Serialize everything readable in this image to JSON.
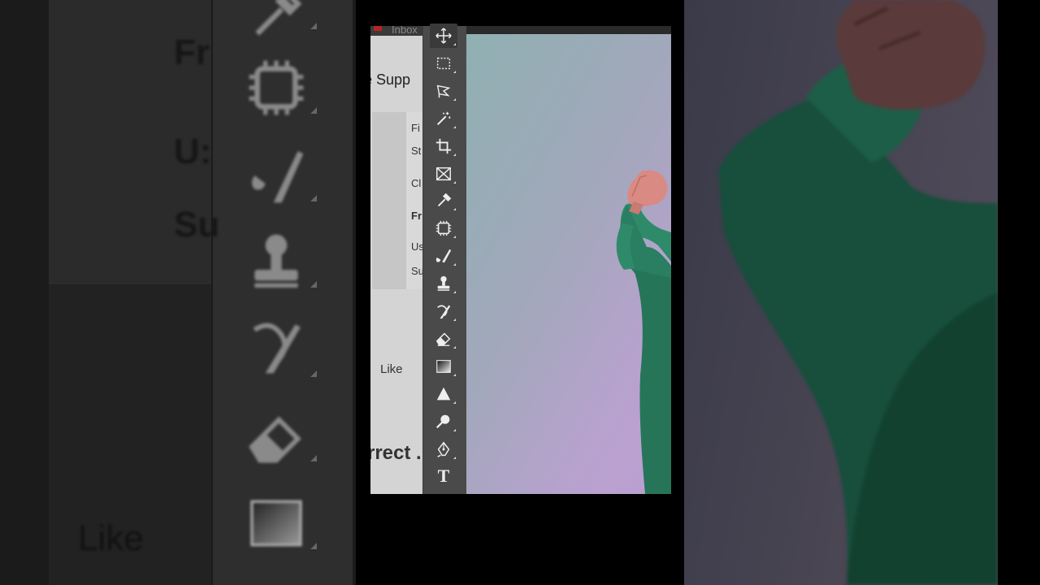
{
  "web_panel": {
    "tab_label": "Inbox",
    "heading": "e Supp",
    "labels": [
      "Fi",
      "St",
      "Cl",
      "Fr",
      "Us",
      "Su"
    ],
    "like_label": "Like",
    "footer_text": "rrect ."
  },
  "left_backdrop": {
    "labels": [
      "Fr",
      "U:",
      "Su"
    ],
    "like_label": "Like"
  },
  "toolbar": {
    "tools": [
      {
        "name": "move-tool",
        "icon": "move-icon",
        "active": true
      },
      {
        "name": "marquee-tool",
        "icon": "rectangle-marquee-icon"
      },
      {
        "name": "lasso-tool",
        "icon": "polygonal-lasso-icon"
      },
      {
        "name": "magic-wand-tool",
        "icon": "magic-wand-icon"
      },
      {
        "name": "crop-tool",
        "icon": "crop-icon"
      },
      {
        "name": "frame-tool",
        "icon": "frame-icon"
      },
      {
        "name": "eyedropper-tool",
        "icon": "eyedropper-icon"
      },
      {
        "name": "spot-healing-tool",
        "icon": "healing-patch-icon"
      },
      {
        "name": "brush-tool",
        "icon": "brush-icon"
      },
      {
        "name": "clone-stamp-tool",
        "icon": "stamp-icon"
      },
      {
        "name": "history-brush-tool",
        "icon": "history-brush-icon"
      },
      {
        "name": "eraser-tool",
        "icon": "eraser-icon"
      },
      {
        "name": "gradient-tool",
        "icon": "gradient-icon"
      },
      {
        "name": "blur-tool",
        "icon": "blur-triangle-icon"
      },
      {
        "name": "dodge-tool",
        "icon": "dodge-icon"
      },
      {
        "name": "pen-tool",
        "icon": "pen-icon"
      },
      {
        "name": "type-tool",
        "icon": "type-icon",
        "label": "T"
      }
    ]
  },
  "colors": {
    "toolbar_bg": "#4a4a4a",
    "icon": "#eeeeee",
    "hoodie": "#2f8a6a",
    "skin": "#d98a82"
  }
}
